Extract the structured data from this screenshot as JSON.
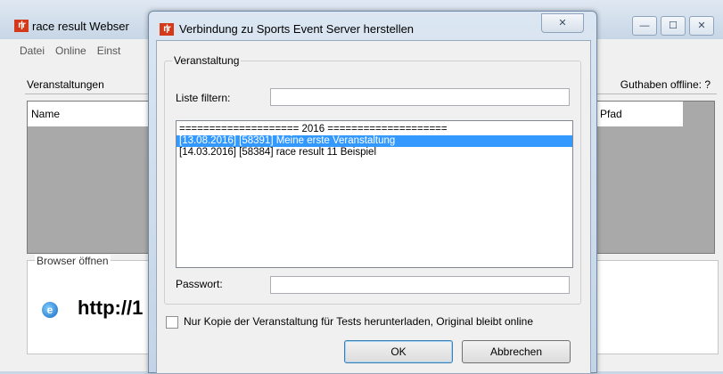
{
  "background_window": {
    "icon_text": "r|r",
    "title": "race result Webser",
    "menu": [
      "Datei",
      "Online",
      "Einst"
    ],
    "events_label": "Veranstaltungen",
    "credit_label": "Guthaben offline: ?",
    "table_headers": [
      "Name",
      "Pfad"
    ],
    "browser_group_label": "Browser öffnen",
    "browser_url": "http://1",
    "window_buttons": {
      "minimize": "—",
      "maximize": "☐",
      "close": "✕"
    }
  },
  "dialog": {
    "icon_text": "r|r",
    "title": "Verbindung zu Sports Event Server herstellen",
    "close_glyph": "✕",
    "group_label": "Veranstaltung",
    "filter_label": "Liste filtern:",
    "filter_value": "",
    "events_list": [
      {
        "text": "==================== 2016 ====================",
        "selected": false
      },
      {
        "text": "[13.08.2016] [58391] Meine erste Veranstaltung",
        "selected": true
      },
      {
        "text": "[14.03.2016] [58384] race result 11 Beispiel",
        "selected": false
      }
    ],
    "password_label": "Passwort:",
    "password_value": "",
    "checkbox_label": "Nur Kopie der Veranstaltung für Tests herunterladen, Original bleibt online",
    "checkbox_checked": false,
    "ok_label": "OK",
    "cancel_label": "Abbrechen"
  },
  "colors": {
    "selection": "#3399ff",
    "brand_icon": "#d43a1a"
  }
}
